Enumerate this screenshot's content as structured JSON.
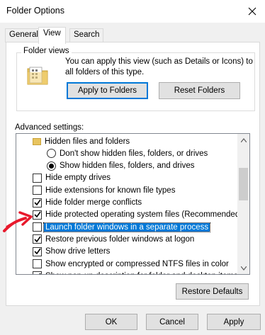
{
  "window": {
    "title": "Folder Options"
  },
  "tabs": [
    {
      "label": "General"
    },
    {
      "label": "View"
    },
    {
      "label": "Search"
    }
  ],
  "folder_views": {
    "legend": "Folder views",
    "description_line1": "You can apply this view (such as Details or Icons) to",
    "description_line2": "all folders of this type.",
    "apply_button": "Apply to Folders",
    "reset_button": "Reset Folders"
  },
  "advanced": {
    "label": "Advanced settings:",
    "items": [
      {
        "type": "folder",
        "label": "Hidden files and folders"
      },
      {
        "type": "radio",
        "checked": false,
        "label": "Don't show hidden files, folders, or drives"
      },
      {
        "type": "radio",
        "checked": true,
        "label": "Show hidden files, folders, and drives"
      },
      {
        "type": "checkbox",
        "checked": false,
        "label": "Hide empty drives"
      },
      {
        "type": "checkbox",
        "checked": false,
        "label": "Hide extensions for known file types"
      },
      {
        "type": "checkbox",
        "checked": true,
        "label": "Hide folder merge conflicts"
      },
      {
        "type": "checkbox",
        "checked": true,
        "label": "Hide protected operating system files (Recommended)"
      },
      {
        "type": "checkbox",
        "checked": false,
        "selected": true,
        "label": "Launch folder windows in a separate process"
      },
      {
        "type": "checkbox",
        "checked": true,
        "label": "Restore previous folder windows at logon"
      },
      {
        "type": "checkbox",
        "checked": true,
        "label": "Show drive letters"
      },
      {
        "type": "checkbox",
        "checked": false,
        "label": "Show encrypted or compressed NTFS files in color"
      },
      {
        "type": "checkbox",
        "checked": true,
        "label": "Show pop-up description for folder and desktop items"
      }
    ],
    "restore_button": "Restore Defaults"
  },
  "footer": {
    "ok": "OK",
    "cancel": "Cancel",
    "apply": "Apply"
  },
  "colors": {
    "accent": "#0078d7",
    "annotation_arrow": "#e8192c"
  }
}
